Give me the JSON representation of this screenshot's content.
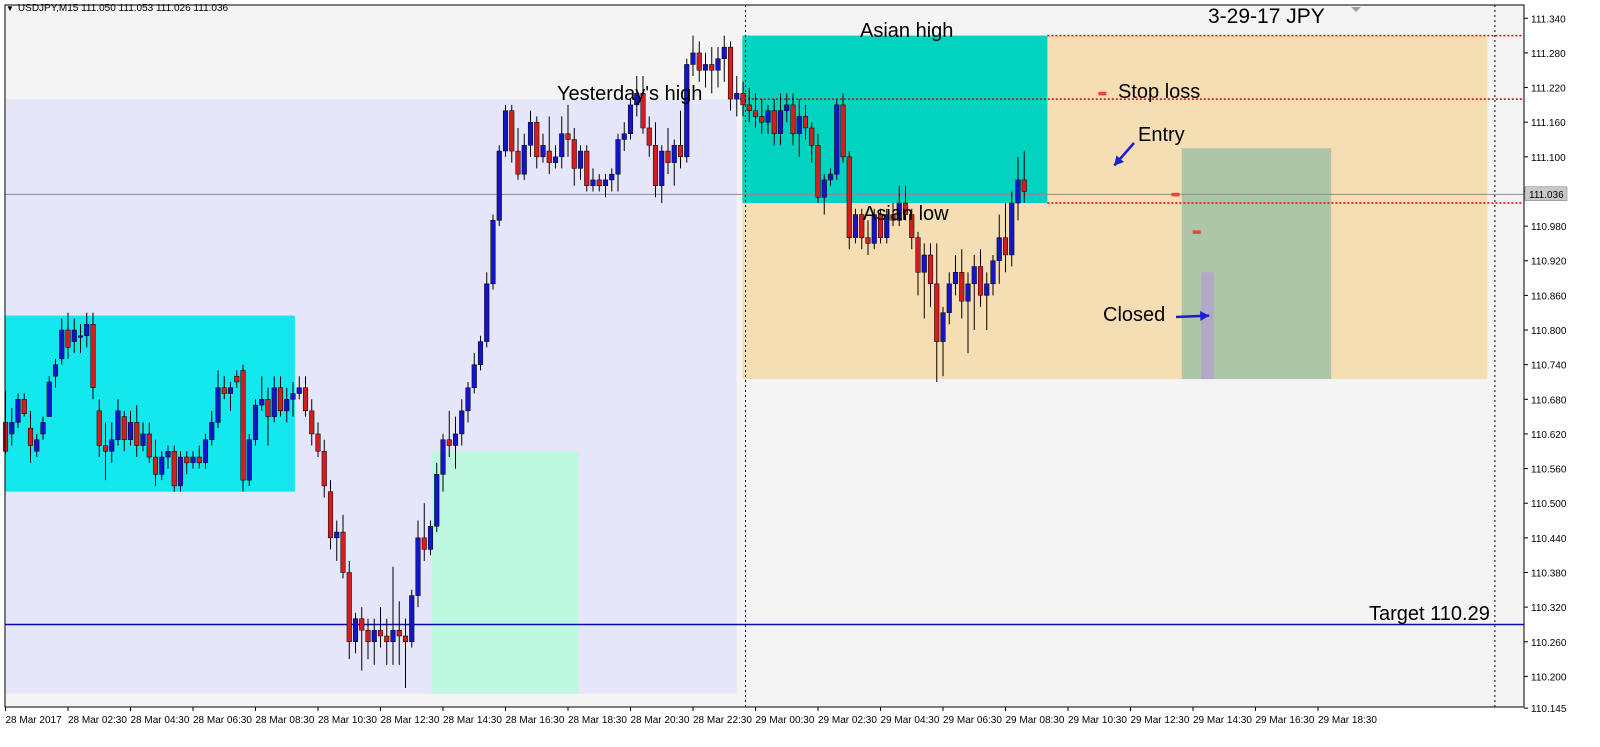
{
  "symbol_info": {
    "symbol": "USDJPY,M15",
    "values": "111.050 111.053 111.026 111.036"
  },
  "colors": {
    "background": "#f4f4f4",
    "frame": "#000000",
    "bull_body": "#1515c8",
    "bear_body": "#d21e1e",
    "wick": "#000000",
    "zone_yesterday": "#e6e6fa",
    "zone_asian_box": "#00d3bf",
    "zone_london": "#f6deb4",
    "zone_left_cyan": "#14e8ef",
    "zone_low_green": "#bff8e0",
    "zone_trade": "#adc6a8",
    "target_line": "#0a0ab4",
    "dotted_red": "#e00000",
    "price_line": "#8c8c8c",
    "arrow": "#1c1cd4",
    "annotation_text": "#000000"
  },
  "chart_data": {
    "type": "candlestick",
    "title": "3-29-17  JPY",
    "instrument": "USDJPY",
    "timeframe": "M15",
    "ylim": [
      110.145,
      111.375
    ],
    "y_ticks": [
      "111.340",
      "111.280",
      "111.220",
      "111.160",
      "111.100",
      "111.040",
      "110.980",
      "110.920",
      "110.860",
      "110.800",
      "110.740",
      "110.680",
      "110.620",
      "110.560",
      "110.500",
      "110.440",
      "110.380",
      "110.320",
      "110.260",
      "110.200",
      "110.145"
    ],
    "x_labels": [
      "28 Mar 2017",
      "28 Mar 02:30",
      "28 Mar 04:30",
      "28 Mar 06:30",
      "28 Mar 08:30",
      "28 Mar 10:30",
      "28 Mar 12:30",
      "28 Mar 14:30",
      "28 Mar 16:30",
      "28 Mar 18:30",
      "28 Mar 20:30",
      "28 Mar 22:30",
      "29 Mar 00:30",
      "29 Mar 02:30",
      "29 Mar 04:30",
      "29 Mar 06:30",
      "29 Mar 08:30",
      "29 Mar 10:30",
      "29 Mar 12:30",
      "29 Mar 14:30",
      "29 Mar 16:30",
      "29 Mar 18:30"
    ],
    "current_price": "111.036",
    "target_price": 110.29,
    "yesterday_high": 111.2,
    "asian_high": 111.31,
    "asian_low": 111.02,
    "stop_loss": 111.21,
    "entry": 111.085,
    "closed": 110.825,
    "candles": [
      [
        110.64,
        110.695,
        110.585,
        110.59
      ],
      [
        110.62,
        110.665,
        110.6,
        110.64
      ],
      [
        110.64,
        110.69,
        110.63,
        110.68
      ],
      [
        110.68,
        110.69,
        110.65,
        110.655
      ],
      [
        110.63,
        110.66,
        110.57,
        110.6
      ],
      [
        110.59,
        110.62,
        110.58,
        110.61
      ],
      [
        110.62,
        110.65,
        110.61,
        110.64
      ],
      [
        110.65,
        110.72,
        110.65,
        110.71
      ],
      [
        110.72,
        110.75,
        110.7,
        110.74
      ],
      [
        110.75,
        110.82,
        110.74,
        110.8
      ],
      [
        110.8,
        110.83,
        110.75,
        110.77
      ],
      [
        110.78,
        110.82,
        110.76,
        110.8
      ],
      [
        110.79,
        110.81,
        110.76,
        110.79
      ],
      [
        110.79,
        110.83,
        110.77,
        110.81
      ],
      [
        110.81,
        110.83,
        110.68,
        110.7
      ],
      [
        110.66,
        110.68,
        110.58,
        110.6
      ],
      [
        110.6,
        110.64,
        110.54,
        110.59
      ],
      [
        110.59,
        110.64,
        110.57,
        110.61
      ],
      [
        110.61,
        110.68,
        110.6,
        110.66
      ],
      [
        110.65,
        110.66,
        110.59,
        110.61
      ],
      [
        110.61,
        110.66,
        110.6,
        110.64
      ],
      [
        110.64,
        110.67,
        110.58,
        110.6
      ],
      [
        110.6,
        110.64,
        110.59,
        110.62
      ],
      [
        110.62,
        110.64,
        110.57,
        110.58
      ],
      [
        110.58,
        110.61,
        110.53,
        110.55
      ],
      [
        110.55,
        110.59,
        110.54,
        110.58
      ],
      [
        110.58,
        110.6,
        110.56,
        110.59
      ],
      [
        110.59,
        110.6,
        110.52,
        110.53
      ],
      [
        110.53,
        110.59,
        110.52,
        110.58
      ],
      [
        110.58,
        110.59,
        110.55,
        110.57
      ],
      [
        110.57,
        110.59,
        110.56,
        110.58
      ],
      [
        110.58,
        110.6,
        110.56,
        110.57
      ],
      [
        110.57,
        110.62,
        110.56,
        110.61
      ],
      [
        110.61,
        110.66,
        110.6,
        110.64
      ],
      [
        110.64,
        110.73,
        110.63,
        110.7
      ],
      [
        110.7,
        110.72,
        110.68,
        110.69
      ],
      [
        110.69,
        110.71,
        110.66,
        110.7
      ],
      [
        110.72,
        110.73,
        110.7,
        110.71
      ],
      [
        110.73,
        110.74,
        110.52,
        110.54
      ],
      [
        110.54,
        110.62,
        110.53,
        110.61
      ],
      [
        110.61,
        110.68,
        110.6,
        110.67
      ],
      [
        110.67,
        110.72,
        110.66,
        110.68
      ],
      [
        110.68,
        110.7,
        110.6,
        110.65
      ],
      [
        110.65,
        110.72,
        110.64,
        110.7
      ],
      [
        110.7,
        110.72,
        110.65,
        110.66
      ],
      [
        110.66,
        110.7,
        110.64,
        110.68
      ],
      [
        110.68,
        110.71,
        110.65,
        110.69
      ],
      [
        110.69,
        110.72,
        110.68,
        110.7
      ],
      [
        110.7,
        110.72,
        110.65,
        110.66
      ],
      [
        110.66,
        110.68,
        110.6,
        110.62
      ],
      [
        110.62,
        110.64,
        110.58,
        110.59
      ],
      [
        110.59,
        110.61,
        110.51,
        110.53
      ],
      [
        110.52,
        110.54,
        110.42,
        110.44
      ],
      [
        110.44,
        110.47,
        110.4,
        110.45
      ],
      [
        110.45,
        110.48,
        110.37,
        110.38
      ],
      [
        110.38,
        110.4,
        110.23,
        110.26
      ],
      [
        110.26,
        110.31,
        110.24,
        110.3
      ],
      [
        110.3,
        110.32,
        110.21,
        110.28
      ],
      [
        110.28,
        110.3,
        110.23,
        110.26
      ],
      [
        110.26,
        110.3,
        110.22,
        110.28
      ],
      [
        110.28,
        110.32,
        110.25,
        110.27
      ],
      [
        110.27,
        110.3,
        110.22,
        110.26
      ],
      [
        110.26,
        110.39,
        110.22,
        110.28
      ],
      [
        110.28,
        110.33,
        110.22,
        110.27
      ],
      [
        110.27,
        110.3,
        110.18,
        110.26
      ],
      [
        110.26,
        110.35,
        110.25,
        110.34
      ],
      [
        110.34,
        110.47,
        110.32,
        110.44
      ],
      [
        110.44,
        110.5,
        110.4,
        110.42
      ],
      [
        110.42,
        110.47,
        110.41,
        110.46
      ],
      [
        110.46,
        110.57,
        110.45,
        110.55
      ],
      [
        110.55,
        110.62,
        110.52,
        110.61
      ],
      [
        110.61,
        110.66,
        110.58,
        110.6
      ],
      [
        110.6,
        110.65,
        110.56,
        110.62
      ],
      [
        110.62,
        110.68,
        110.6,
        110.66
      ],
      [
        110.66,
        110.71,
        110.64,
        110.7
      ],
      [
        110.7,
        110.76,
        110.69,
        110.74
      ],
      [
        110.74,
        110.79,
        110.73,
        110.78
      ],
      [
        110.78,
        110.9,
        110.77,
        110.88
      ],
      [
        110.88,
        111.0,
        110.87,
        110.99
      ],
      [
        110.99,
        111.12,
        110.98,
        111.11
      ],
      [
        111.11,
        111.19,
        111.1,
        111.18
      ],
      [
        111.18,
        111.19,
        111.09,
        111.11
      ],
      [
        111.11,
        111.15,
        111.06,
        111.07
      ],
      [
        111.07,
        111.14,
        111.06,
        111.12
      ],
      [
        111.12,
        111.18,
        111.1,
        111.16
      ],
      [
        111.16,
        111.17,
        111.08,
        111.1
      ],
      [
        111.1,
        111.14,
        111.09,
        111.12
      ],
      [
        111.11,
        111.17,
        111.07,
        111.09
      ],
      [
        111.09,
        111.12,
        111.08,
        111.1
      ],
      [
        111.1,
        111.17,
        111.08,
        111.14
      ],
      [
        111.14,
        111.19,
        111.1,
        111.13
      ],
      [
        111.13,
        111.15,
        111.05,
        111.08
      ],
      [
        111.08,
        111.12,
        111.06,
        111.11
      ],
      [
        111.11,
        111.12,
        111.04,
        111.05
      ],
      [
        111.05,
        111.08,
        111.04,
        111.06
      ],
      [
        111.06,
        111.07,
        111.04,
        111.05
      ],
      [
        111.05,
        111.07,
        111.03,
        111.06
      ],
      [
        111.06,
        111.08,
        111.04,
        111.07
      ],
      [
        111.07,
        111.14,
        111.04,
        111.13
      ],
      [
        111.13,
        111.16,
        111.11,
        111.14
      ],
      [
        111.14,
        111.2,
        111.13,
        111.19
      ],
      [
        111.19,
        111.24,
        111.17,
        111.21
      ],
      [
        111.21,
        111.24,
        111.14,
        111.15
      ],
      [
        111.15,
        111.17,
        111.1,
        111.12
      ],
      [
        111.12,
        111.16,
        111.03,
        111.05
      ],
      [
        111.05,
        111.12,
        111.02,
        111.11
      ],
      [
        111.11,
        111.15,
        111.07,
        111.09
      ],
      [
        111.09,
        111.13,
        111.05,
        111.12
      ],
      [
        111.12,
        111.18,
        111.08,
        111.1
      ],
      [
        111.1,
        111.27,
        111.09,
        111.26
      ],
      [
        111.26,
        111.31,
        111.24,
        111.28
      ],
      [
        111.28,
        111.3,
        111.23,
        111.25
      ],
      [
        111.25,
        111.28,
        111.22,
        111.26
      ],
      [
        111.26,
        111.29,
        111.21,
        111.25
      ],
      [
        111.25,
        111.29,
        111.22,
        111.27
      ],
      [
        111.27,
        111.31,
        111.23,
        111.29
      ],
      [
        111.29,
        111.3,
        111.18,
        111.2
      ],
      [
        111.2,
        111.24,
        111.17,
        111.21
      ],
      [
        111.21,
        111.23,
        111.17,
        111.19
      ],
      [
        111.19,
        111.22,
        111.16,
        111.18
      ],
      [
        111.18,
        111.21,
        111.15,
        111.17
      ],
      [
        111.17,
        111.2,
        111.14,
        111.16
      ],
      [
        111.16,
        111.19,
        111.14,
        111.18
      ],
      [
        111.18,
        111.2,
        111.12,
        111.14
      ],
      [
        111.14,
        111.21,
        111.12,
        111.18
      ],
      [
        111.18,
        111.21,
        111.16,
        111.19
      ],
      [
        111.19,
        111.21,
        111.12,
        111.14
      ],
      [
        111.14,
        111.2,
        111.1,
        111.17
      ],
      [
        111.17,
        111.19,
        111.13,
        111.15
      ],
      [
        111.15,
        111.16,
        111.09,
        111.12
      ],
      [
        111.12,
        111.14,
        111.02,
        111.03
      ],
      [
        111.03,
        111.07,
        111.0,
        111.06
      ],
      [
        111.06,
        111.08,
        111.05,
        111.07
      ],
      [
        111.07,
        111.2,
        111.06,
        111.19
      ],
      [
        111.19,
        111.21,
        111.09,
        111.1
      ],
      [
        111.1,
        111.11,
        110.94,
        110.96
      ],
      [
        110.96,
        111.01,
        110.95,
        111.0
      ],
      [
        111.0,
        111.01,
        110.94,
        110.96
      ],
      [
        110.96,
        110.99,
        110.93,
        110.95
      ],
      [
        110.95,
        111.01,
        110.94,
        111.0
      ],
      [
        111.0,
        111.01,
        110.95,
        110.96
      ],
      [
        110.96,
        111.01,
        110.95,
        111.0
      ],
      [
        111.0,
        111.02,
        110.98,
        110.99
      ],
      [
        110.99,
        111.05,
        110.98,
        111.02
      ],
      [
        111.02,
        111.05,
        110.99,
        111.0
      ],
      [
        111.0,
        111.01,
        110.94,
        110.96
      ],
      [
        110.96,
        110.97,
        110.86,
        110.9
      ],
      [
        110.9,
        110.95,
        110.82,
        110.93
      ],
      [
        110.93,
        110.95,
        110.84,
        110.88
      ],
      [
        110.88,
        110.95,
        110.71,
        110.78
      ],
      [
        110.78,
        110.84,
        110.72,
        110.83
      ],
      [
        110.83,
        110.9,
        110.81,
        110.88
      ],
      [
        110.88,
        110.93,
        110.86,
        110.9
      ],
      [
        110.9,
        110.94,
        110.82,
        110.85
      ],
      [
        110.85,
        110.9,
        110.76,
        110.88
      ],
      [
        110.88,
        110.93,
        110.8,
        110.91
      ],
      [
        110.91,
        110.94,
        110.84,
        110.86
      ],
      [
        110.86,
        110.9,
        110.8,
        110.88
      ],
      [
        110.88,
        110.93,
        110.86,
        110.92
      ],
      [
        110.92,
        111.0,
        110.88,
        110.96
      ],
      [
        110.96,
        111.02,
        110.9,
        110.93
      ],
      [
        110.93,
        111.04,
        110.91,
        111.02
      ],
      [
        111.02,
        111.1,
        110.99,
        111.06
      ],
      [
        111.06,
        111.11,
        111.02,
        111.04
      ]
    ],
    "annotations": {
      "yesterday_high": "Yesterday's high",
      "asian_high": "Asian high",
      "asian_low": "Asian low",
      "stop_loss": "Stop loss",
      "entry": "Entry",
      "closed": "Closed",
      "target": "Target  110.29"
    }
  }
}
